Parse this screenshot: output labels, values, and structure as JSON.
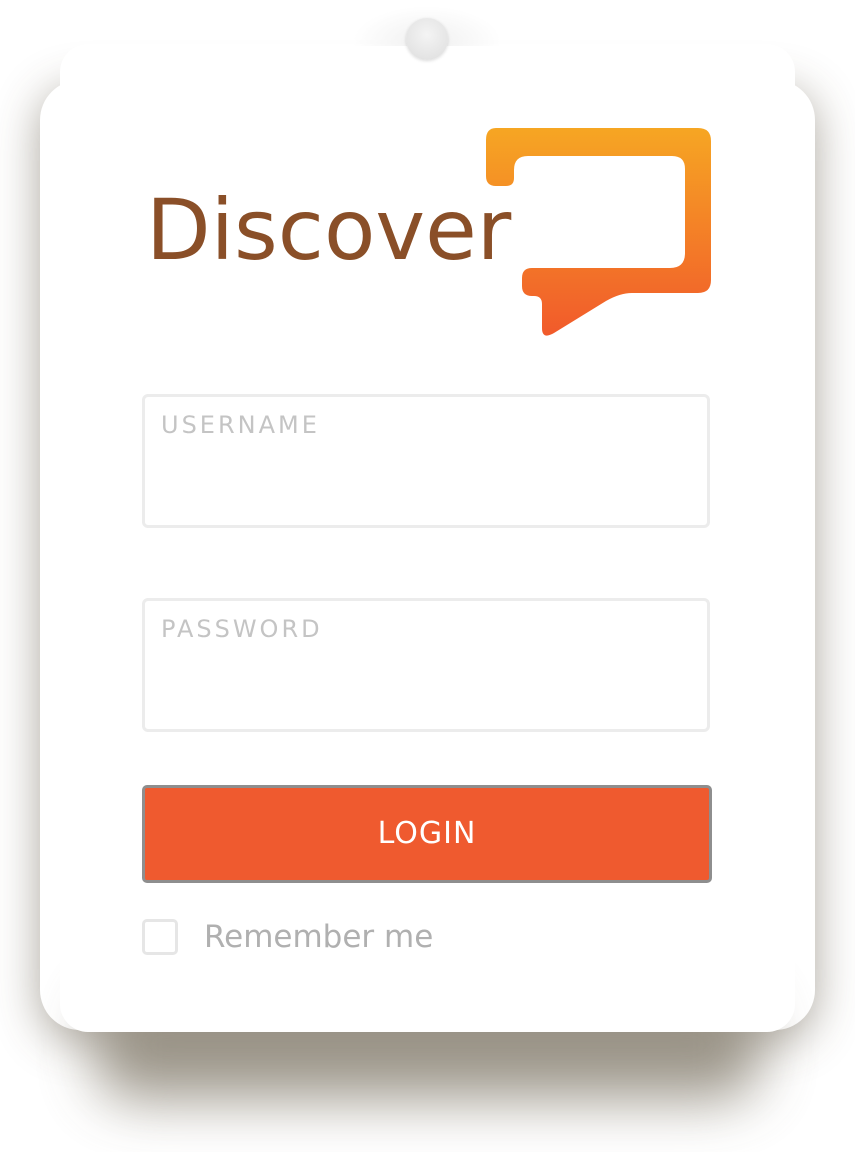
{
  "brand": {
    "name": "Discover",
    "word_color": "#8a4f28",
    "bubble_gradient_top": "#f6a623",
    "bubble_gradient_bottom": "#f15a2b"
  },
  "form": {
    "username": {
      "label": "USERNAME",
      "value": ""
    },
    "password": {
      "label": "PASSWORD",
      "value": ""
    },
    "login_button": {
      "label": "LOGIN",
      "color": "#ef5a2f"
    },
    "remember_me": {
      "label": "Remember me",
      "checked": false
    }
  }
}
